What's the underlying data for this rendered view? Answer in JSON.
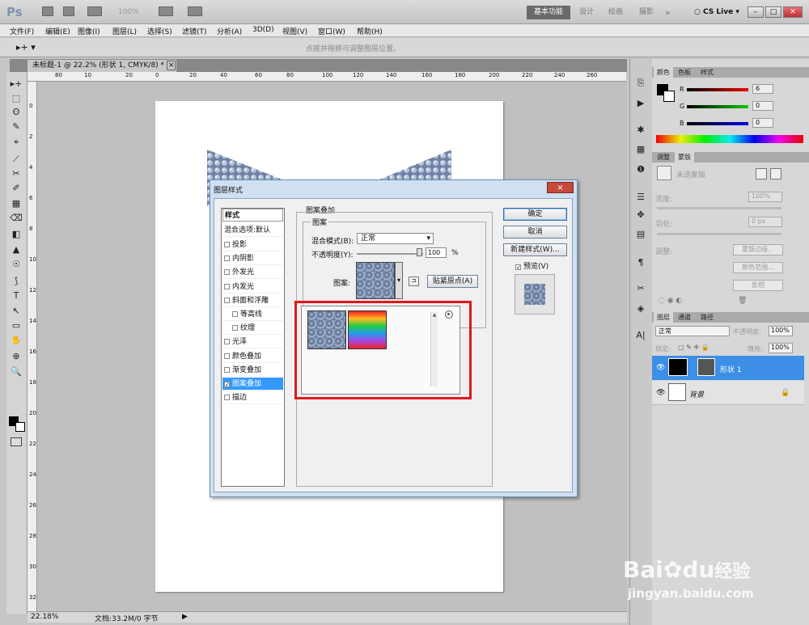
{
  "app": {
    "logo": "Ps",
    "zoom_combo": "100%",
    "cs_live": "CS Live"
  },
  "workspaces": [
    {
      "label": "基本功能"
    },
    {
      "label": "设计"
    },
    {
      "label": "绘画"
    },
    {
      "label": "摄影"
    },
    {
      "label": "»"
    }
  ],
  "menu": [
    "文件(F)",
    "编辑(E)",
    "图像(I)",
    "图层(L)",
    "选择(S)",
    "滤镜(T)",
    "分析(A)",
    "3D(D)",
    "视图(V)",
    "窗口(W)",
    "帮助(H)"
  ],
  "options_hint": "点按并拖移可调整图层位置。",
  "document": {
    "tab_title": "未标题-1 @ 22.2% (形状 1, CMYK/8) *",
    "tab_close": "×"
  },
  "ruler_h": [
    "60",
    "80",
    "10",
    "20",
    "0",
    "20",
    "40",
    "60",
    "80",
    "100",
    "120",
    "140",
    "160",
    "180",
    "200",
    "220",
    "240",
    "260"
  ],
  "ruler_v": [
    "0",
    "2",
    "4",
    "6",
    "8",
    "10",
    "12",
    "14",
    "16",
    "18",
    "20",
    "22",
    "24",
    "26",
    "28",
    "30",
    "32"
  ],
  "status": {
    "zoom": "22.18%",
    "doc_size": "文档:33.2M/0 字节"
  },
  "tools": [
    "▸+",
    "⬚",
    "ʘ",
    "✎",
    "⌖",
    "⟋",
    "✂",
    "✐",
    "▦",
    "⌫",
    "◧",
    "▲",
    "☉",
    "⟆",
    "T",
    "↖",
    "▭",
    "✋",
    "⊕",
    "🔍"
  ],
  "dialog": {
    "title": "图层样式",
    "close": "×",
    "section_title": "图案叠加",
    "group_title": "图案",
    "blend_label": "混合模式(B):",
    "blend_value": "正常",
    "opacity_label": "不透明度(Y):",
    "opacity_value": "100",
    "opacity_unit": "%",
    "pattern_label": "图案:",
    "snap_button": "贴紧原点(A)",
    "buttons": {
      "ok": "确定",
      "cancel": "取消",
      "new_style": "新建样式(W)...",
      "preview": "预览(V)"
    },
    "style_header": "样式",
    "blend_options": "混合选项:默认",
    "styles": [
      {
        "label": "投影",
        "checked": false
      },
      {
        "label": "内阴影",
        "checked": false
      },
      {
        "label": "外发光",
        "checked": false
      },
      {
        "label": "内发光",
        "checked": false
      },
      {
        "label": "斜面和浮雕",
        "checked": false
      },
      {
        "label": "等高线",
        "checked": false
      },
      {
        "label": "纹理",
        "checked": false
      },
      {
        "label": "光泽",
        "checked": false
      },
      {
        "label": "颜色叠加",
        "checked": false
      },
      {
        "label": "渐变叠加",
        "checked": false
      },
      {
        "label": "图案叠加",
        "checked": true
      },
      {
        "label": "描边",
        "checked": false
      }
    ]
  },
  "color_panel": {
    "tabs": [
      "颜色",
      "色板",
      "样式"
    ],
    "r": {
      "label": "R",
      "value": "6"
    },
    "g": {
      "label": "G",
      "value": "0"
    },
    "b": {
      "label": "B",
      "value": "0"
    }
  },
  "mask_panel": {
    "tabs": [
      "调整",
      "蒙版"
    ],
    "no_mask": "未选蒙版",
    "density_label": "浓度:",
    "density_value": "100%",
    "feather_label": "羽化:",
    "feather_value": "0 px",
    "refine_label": "调整:",
    "buttons": [
      "蒙版边缘...",
      "颜色范围...",
      "反相"
    ]
  },
  "layers_panel": {
    "tabs": [
      "图层",
      "通道",
      "路径"
    ],
    "blend": "正常",
    "opacity_label": "不透明度:",
    "opacity_value": "100%",
    "lock_label": "锁定:",
    "fill_label": "填充:",
    "fill_value": "100%",
    "layers": [
      {
        "name": "形状 1",
        "selected": true
      },
      {
        "name": "背景",
        "selected": false
      }
    ]
  },
  "watermark": {
    "brand": "Bai",
    "brand2": "du",
    "cn": "经验",
    "url": "jingyan.baidu.com"
  }
}
